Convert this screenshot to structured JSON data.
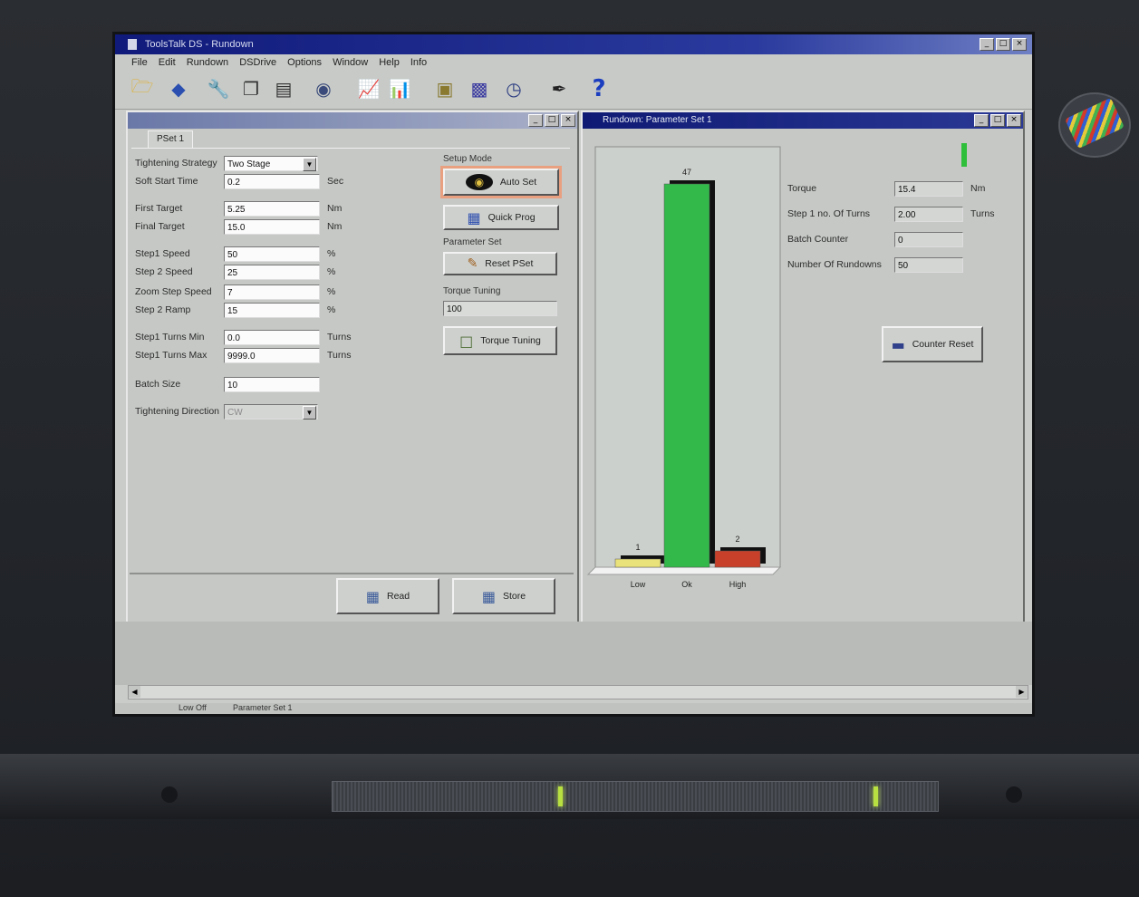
{
  "app": {
    "title": "ToolsTalk DS - Rundown",
    "window_buttons": [
      "_",
      "□",
      "×"
    ]
  },
  "menu": [
    "File",
    "Edit",
    "Rundown",
    "DSDrive",
    "Options",
    "Window",
    "Help",
    "Info"
  ],
  "toolbar": {
    "icons": [
      "open-folder-icon",
      "diamond-icon",
      "wrench-icon",
      "copy-icon",
      "save-icon",
      "disk-icon",
      "line-chart-icon",
      "bar-chart-icon",
      "controller-icon",
      "box-icon",
      "gauge-icon",
      "screwdriver-icon",
      "help-icon"
    ],
    "help_glyph": "?"
  },
  "programming": {
    "tab": "PSet 1",
    "rows": [
      {
        "label": "Tightening Strategy",
        "value": "Two Stage",
        "unit": "",
        "type": "combo"
      },
      {
        "label": "Soft Start Time",
        "value": "0.2",
        "unit": "Sec",
        "type": "text"
      },
      {
        "label": "First Target",
        "value": "5.25",
        "unit": "Nm",
        "type": "text"
      },
      {
        "label": "Final Target",
        "value": "15.0",
        "unit": "Nm",
        "type": "text"
      },
      {
        "label": "Step1 Speed",
        "value": "50",
        "unit": "%",
        "type": "text"
      },
      {
        "label": "Step 2 Speed",
        "value": "25",
        "unit": "%",
        "type": "text"
      },
      {
        "label": "Zoom Step Speed",
        "value": "7",
        "unit": "%",
        "type": "text"
      },
      {
        "label": "Step 2 Ramp",
        "value": "15",
        "unit": "%",
        "type": "text"
      },
      {
        "label": "Step1 Turns Min",
        "value": "0.0",
        "unit": "Turns",
        "type": "text"
      },
      {
        "label": "Step1 Turns Max",
        "value": "9999.0",
        "unit": "Turns",
        "type": "text"
      },
      {
        "label": "Batch Size",
        "value": "10",
        "unit": "",
        "type": "text"
      },
      {
        "label": "Tightening Direction",
        "value": "CW",
        "unit": "",
        "type": "combo-disabled"
      }
    ],
    "setup_mode": {
      "title": "Setup Mode",
      "auto_set": "Auto Set",
      "quick_prog": "Quick Prog"
    },
    "parameter_set": {
      "title": "Parameter Set",
      "reset": "Reset PSet"
    },
    "torque_tuning": {
      "title": "Torque Tuning",
      "value": "100",
      "button": "Torque Tuning"
    },
    "read": "Read",
    "store": "Store"
  },
  "rundown": {
    "title": "Rundown: Parameter Set 1",
    "fields": [
      {
        "label": "Torque",
        "value": "15.4",
        "unit": "Nm"
      },
      {
        "label": "Step 1 no. Of Turns",
        "value": "2.00",
        "unit": "Turns"
      },
      {
        "label": "Batch Counter",
        "value": "0",
        "unit": ""
      },
      {
        "label": "Number Of Rundowns",
        "value": "50",
        "unit": ""
      }
    ],
    "counter_reset": "Counter Reset",
    "status_color": "#2fbf3a"
  },
  "chart_data": {
    "type": "bar",
    "categories": [
      "Low",
      "Ok",
      "High"
    ],
    "values": [
      1,
      47,
      2
    ],
    "data_labels": [
      "1",
      "47",
      "2"
    ],
    "colors": [
      "#e9e27a",
      "#33b84a",
      "#c8402a"
    ],
    "ylim": [
      0,
      50
    ]
  },
  "taskbar": {
    "items": [
      "Low Off",
      "Parameter Set 1"
    ]
  }
}
